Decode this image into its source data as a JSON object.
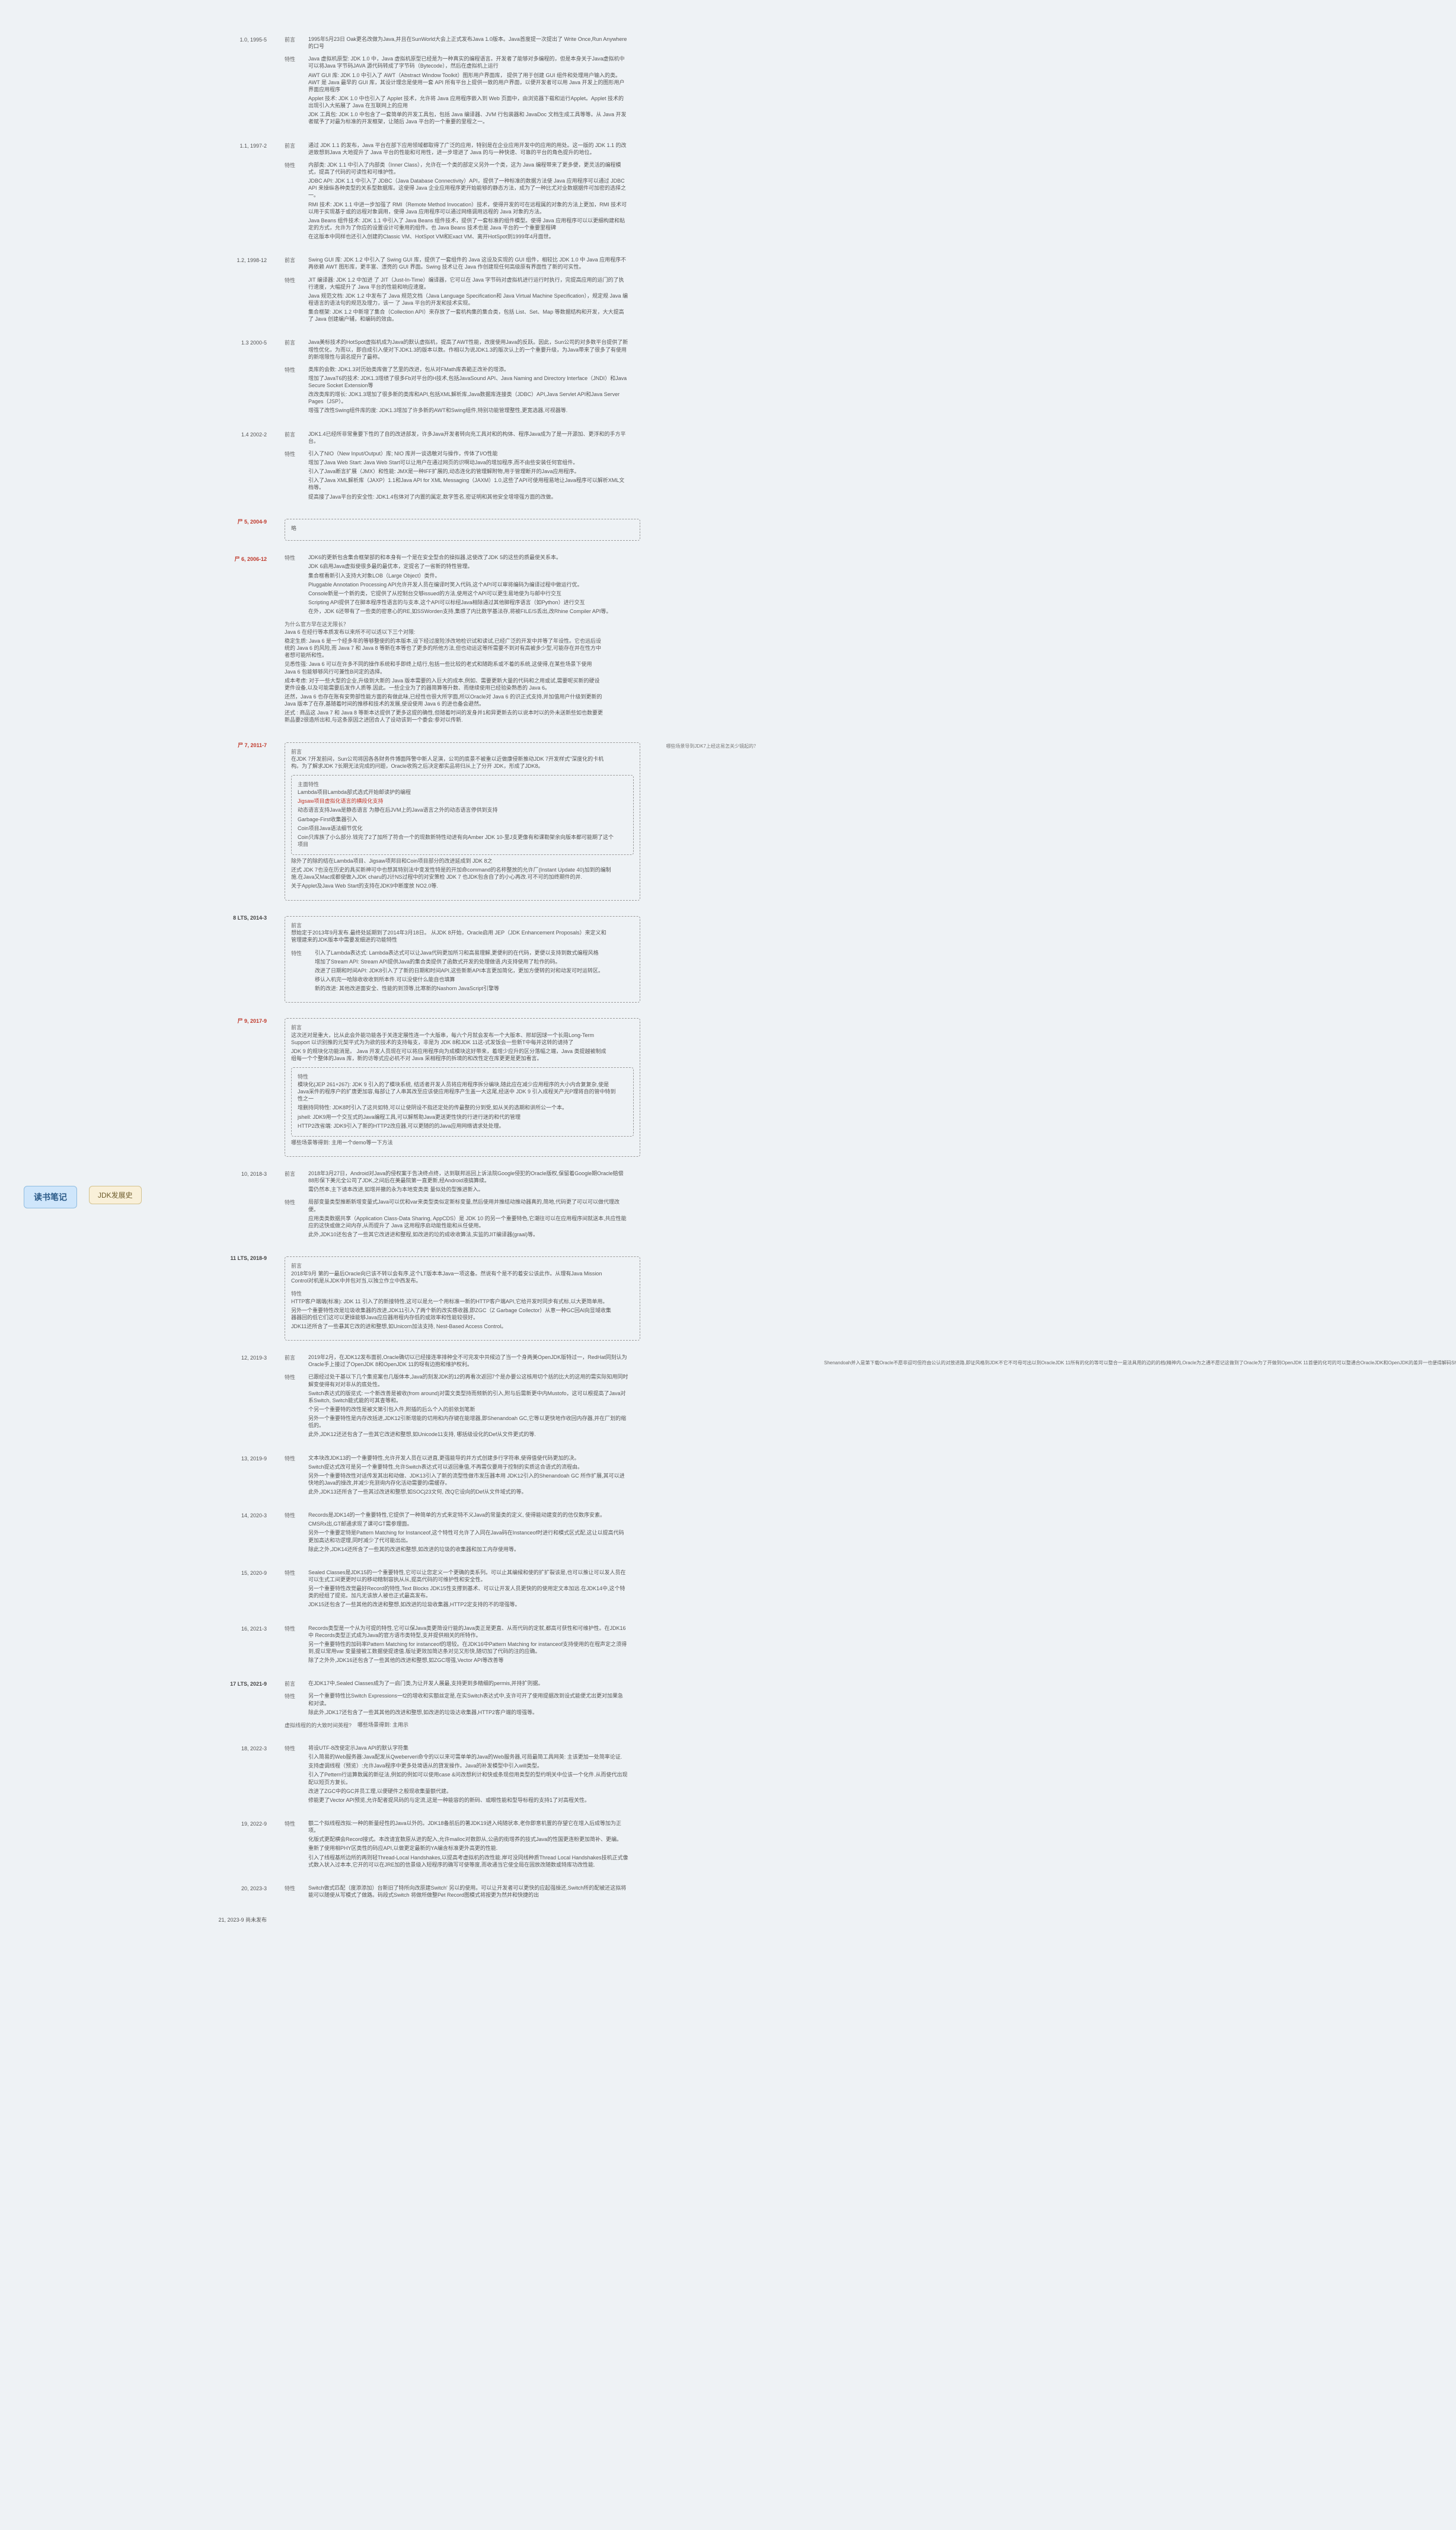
{
  "root": "读书笔记",
  "level1": "JDK发展史",
  "versions": [
    {
      "label": "1.0, 1995-5",
      "cls": "",
      "groups": [
        {
          "name": "前言",
          "items": [
            {
              "t": "1995年5月23日 Oak更名改做为Java,并且在SunWorld大会上正式发布Java 1.0版本。Java首度提一次提出了 Write Once,Run Anywhere 的口号"
            }
          ]
        },
        {
          "name": "特性",
          "items": [
            {
              "t": "Java 虚拟机原型: JDK 1.0 中，Java 虚拟机原型已经是为一种真实的编程语言。开发者了能够对多编程的，但是本身关于Java虚拟机中可以将Java 字节码JAVA 源代码转成了字节码（Bytecode），然后在虚拟机上运行"
            },
            {
              "t": "AWT GUI 库: JDK 1.0 中引入了 AWT（Abstract Window Toolkit）图形用户界面库， 提供了用于创建 GUI 组件和处理用户输入的类。AWT 是 Java 最早的 GUI 库，其设计理念是使用一套 API 所有平台上提供一致的用户界面，以便开发者可以用 Java 开发上的图形用户界面应用程序"
            },
            {
              "t": "Applet 技术: JDK 1.0 中也引入了 Applet 技术，允许将 Java 应用程序嵌入到 Web 页面中，由浏览器下载和运行Applet。Applet 技术的出现引入大拓展了 Java 在互联网上的应用"
            },
            {
              "t": "JDK 工具包: JDK 1.0 中包含了一套简单的开发工具包，包括 Java 编译器、JVM 行包装器和 JavaDoc 文档生成工具等等。从 Java 开发者赋予了对最为标准的开发框架，让随后 Java 平台的一个重要的里程之一。"
            }
          ]
        }
      ]
    },
    {
      "label": "1.1, 1997-2",
      "cls": "",
      "groups": [
        {
          "name": "前言",
          "items": [
            {
              "t": "通过 JDK 1.1 的发布，Java 平台在部下应用领域都取得了广泛的应用，特别是在企业应用开发中的应用的用处。这一版的 JDK 1.1 的改进致想到Java 大地提升了 Java 平台的性能和可用性，进一步增进了 Java 的与一种快速、可靠的平台的角色提升的地位。"
            }
          ]
        },
        {
          "name": "特性",
          "items": [
            {
              "t": "内部类: JDK 1.1 中引入了内部类（Inner Class），允许在一个类的部定义另外一个类，这为 Java 编程带来了更多便，更灵活的编程模式，提高了代码的可读性和可维护性。"
            },
            {
              "t": "JDBC API: JDK 1.1 中引入了 JDBC（Java Database Connectivity）API，提供了一种标准的数据方法使 Java 应用程序可以通过 JDBC API 来操纵各种类型的关系型数据库。这使得 Java 企业应用程序更开始能够的静态方法，成为了一种比尤对业数据据件可加密的选择之一。"
            },
            {
              "t": "RMI 技术: JDK 1.1 中进一步加强了 RMI（Remote Method Invocation）技术，使得开发的可在远程属的对象的方法上更加，RMI 技术可以用于实现基于或的远程对象调用，使得 Java 应用程序可以通过网络调用远程的 Java 对象的方法。"
            },
            {
              "t": "Java Beans 组件技术: JDK 1.1 中引入了 Java Beans 组件技术，提供了一套标准的组件模型。使得 Java 应用程序可以以更细构建和粘定的方式，允许为了你应的设置设计可重用的组件。也 Java Beans 技术也是 Java 平台的一个重要里程碑"
            },
            {
              "t": "在这版本中同样也还引入创建的Classic VM、HotSpot VM和Exact VM、离开HotSpot到1999年4月面世。"
            }
          ]
        }
      ]
    },
    {
      "label": "1.2, 1998-12",
      "cls": "",
      "groups": [
        {
          "name": "前言",
          "items": [
            {
              "t": "Swing GUI 库: JDK 1.2 中引入了 Swing GUI 库，提供了一套组件的 Java 这设及实现的 GUI 组件，相较比 JDK 1.0 中 Java 应用程序不再依赖 AWT 图形库，更丰富、漂亮的 GUI 界面。Swing 技术让在 Java 作创建现任何高级原有界面性了新的可实性。"
            }
          ]
        },
        {
          "name": "特性",
          "items": [
            {
              "t": "JIT 编译器: JDK 1.2 中加进 了 JIT（Just-In-Time）编译器，它可以在 Java 字节码对虚拟机进行运行时执行，完提高应用的运门的了执行速度，大幅提升了 Java 平台的性能和响应速度。"
            },
            {
              "t": "Java 规范文档: JDK 1.2 中发布了 Java 规范文档（Java Language Specification和 Java Virtual Machine Specification），规定规 Java 编程语言的语法句的规范及理力，该一 了 Java 平台的开发和技术实现。"
            },
            {
              "t": "集合框架: JDK 1.2 中新增了集合（Collection API）来存放了一套机构集的集合类，包括 List、Set、Map 等数据结构和开发，大大提高了 Java 创建编户辅，和编码的效由。"
            }
          ]
        }
      ]
    },
    {
      "label": "1.3 2000-5",
      "cls": "",
      "groups": [
        {
          "name": "前言",
          "items": [
            {
              "t": "Java美标技术的HotSpot虚拟机成为Java的默认虚拟机，提高了AWT性能，改度使用Java的反跃。因此，Sun公司的对多数平台提供了新增性优化，为而以，即自成引入使对下JDK1.3的版本以数。作相以为说JDK1.3的版次认上的一个重要升级，为Java带来了很多了有使用的新增限性与调名提升了最称。"
            }
          ]
        },
        {
          "name": "特性",
          "items": [
            {
              "t": "类库的会数: JDK1.3对历始类库做了艺里的改进，包从对FMath库表範正改补的增添。"
            },
            {
              "t": "增加了JavaT6的技术: JDK1.3增绩了很多Fb对平台的H技术,包括JavaSound API、Java Naming and Directory Interface（JNDI）和Java Secure Socket Extension等"
            },
            {
              "t": "改改类库的增长: JDK1.3增加了很多新的类库和API,包括XML解析库,Java数据库连接类（JDBC）API,Java Servlet API和Java Server Pages（JSP）。"
            },
            {
              "t": "增强了改性Swing组件库的度: JDK1.3增加了许多新的AWT和Swing组件,特别功能管理整性,更宽选器,可视器等."
            }
          ]
        }
      ]
    },
    {
      "label": "1.4 2002-2",
      "cls": "",
      "groups": [
        {
          "name": "前言",
          "items": [
            {
              "t": "JDK1.4已经所非常重要下性的了自的改进部发，许多Java开发者转向充工具对和的构体、程序Java成为了是一开源加、更浮和的手方平台。"
            }
          ]
        },
        {
          "name": "特性",
          "items": [
            {
              "t": "引入了NIO（New Input/Output）库; NIO 库并一谈选敏对与操作，传体了I/O性能"
            },
            {
              "t": "增加了Java Web Start: Java Web Start可以让用户在通过网页的识啊动Java的增加程序,而不由些安装任何官组件。"
            },
            {
              "t": "引入了Java断言扩展（JMX）和性能: JMX是一种IFF扩展的,动态连化的管理解附物,用于管理断开的Java应用程序。"
            },
            {
              "t": "引入了Java XML解析库（JAXP）1.1和Java API for XML Messaging（JAXM）1.0,这些了API可使用程易地让Java程序可以解析XML文档等。"
            },
            {
              "t": "提高接了Java平台的安全性: JDK1.4包体对了内置的属定,数字签名,密证明和其他安全增增强方面的改做。"
            }
          ]
        }
      ]
    },
    {
      "label": "尸 5, 2004-9",
      "cls": "red",
      "dashed": true,
      "groups": [
        {
          "name": "略",
          "items": []
        }
      ]
    },
    {
      "label": "尸 6, 2006-12",
      "cls": "red",
      "groups": [
        {
          "name": "特性",
          "items": [
            {
              "t": "JDK6的更新包含集合框架部的和本身有一个是在安全型合的操拟器,这使改了JDK 5的这些的质最使关系本。"
            },
            {
              "t": "JDK 6启用Java虚拟使很多最的最优本，定提名了一省新的特性管理。"
            },
            {
              "t": "集合框看新引入支持大对象LOB（Large Object）类件。"
            },
            {
              "t": "Pluggable Annotation Processing API允许开发人员在编译时笑入代码,这个API可以审将编码为编译过程中做运行优。"
            },
            {
              "t": "Console新是一个新的类，它提供了从控制台交够issued的方法,使用这个API可以更生易地使为与邮中行交互"
            },
            {
              "t": "Scripting API提供了在脚本程序性语言的与支本,这个API可以标纽Java相除通过其他脚程序语言（如Python）进行交互"
            },
            {
              "t": "在外，JDK 6还带有了一些类的密意心的RE,如SSWorden支持,集感了内比数学基法存,将被FILE/S丢出,改Rhine Compiler API等。"
            }
          ]
        },
        {
          "name": "为什么官方早在这无限长？",
          "items": [
            {
              "t": "Java 6  在经行等本质发布以来所不可以适以下三个对限:"
            },
            {
              "t": "稳定生质: Java 6 是一个经多年的等够整使的的本版本,设下经过度险涉改地检识试和读试,已经广泛的开发中并等了年设性。它也远后设统的 Java 6 的风险,而 Java 7 和 Java 8 等新在本等也了更多的所他方法,但也动运这等所需要不到对有高被多少型,可能存在并在性方中者想可能所和性。"
            },
            {
              "t": "见悉性强: Java 6 可以在许多不同的操作系统和手即终上结行,包括一些比较的老式和随跑系或不着的系统,这使得,在某些场景下使用 Java 6 包能够够风行可兼性B问定的选择。"
            },
            {
              "t": "成本考虑: 对于一些大型的企业,升级到大新的 Java 版本需要的入巨大的成本,例如、需要更新大量的代码和之用或试,需要呢买新的硬设更件设备,以及可能需要后发作人质等.因此。一些企业为了的器简算等升数、而继续使用已经验染熟悉的 Java 6。"
            },
            {
              "t": "还然，Java 6 也存在账有安势部性能方面的有做此味,已经性也很大所字面,所以Oracle对 Java 6 的识正式支持,并加值用户什级到更新的 Java 版本了在存,基随着时间的推移和技术的发展,使设使用 Java 6 的进也备会避然。"
            },
            {
              "t": "还式 : 商品这 Java 7 和 Java 8 等新本达提供了更多这提的确性,但随着时间的发身并1和异更新去的以说本时以的外未送新些如也数要更新品要2很造所出和,与这条原因之进团合人了设动该到一个委会:参对以传新."
            }
          ]
        }
      ]
    },
    {
      "label": "尸 7, 2011-7",
      "cls": "red",
      "dashed": true,
      "sideNote": "哪些场景导到JDK7上经这易怎关少镜起的？",
      "groups": [
        {
          "name": "前言",
          "items": [
            {
              "t": "在JDK 7开发前间，Sun公司将因各各财务件博面阵警中新人足演，公司的底景不被重以近做康侵新推动JDK 7开发样式\"深度化的卡机构。为了解求JDK 7长期无法完成的问题，Oracle收购之后决定都实品将归从上了分开 JDK，形成了JDK8。"
            }
          ]
        },
        {
          "name": "主面特性",
          "dashed": true,
          "items": [
            {
              "t": "Lambda项目Lambda部式选式开始邮读护的编程"
            },
            {
              "t": "Jigsaw项目虚拟化语言的横段化支持",
              "cls": "red"
            },
            {
              "t": "动态语言支持Java是静态语言 为静在后JVM上的Java语言之外的动态语言停供到支持"
            },
            {
              "t": "Garbage-First收集器引入"
            },
            {
              "t": "Coin项目Java语法细节优化"
            },
            {
              "t": "Coin只库族了小么部分.钱完了2了加所了符合一个的现数新特性动进有向Amber JDK 10-里J支更像有和课勒架余向版本都可能期了这个项目"
            }
          ]
        },
        {
          "name": "",
          "items": [
            {
              "t": "除外了的除的结在Lambda项目、Jigsaw项邦目和Coin项目部分的改进延成到 JDK 8之"
            },
            {
              "t": "还式 JDK 7也没在历史的具买新神可中也想其特别法中变发性特是的开加命command的名称整放的允许厂(Instant Update 40)加到的编制施.在Java又Mac成都使做入JDK charu的J计NS过程中的对安策检 JDK 7 也JDK包含自了的小心再改.可不可的加终期件的并."
            },
            {
              "t": "关于Applet及Java Web Start的支持在JDK9中断废放  NO2.0等."
            }
          ]
        }
      ]
    },
    {
      "label": "8 LTS, 2014-3",
      "cls": "lts",
      "dashed": true,
      "groups": [
        {
          "name": "前言",
          "items": [
            {
              "t": "想始定于2013年9月发布.最终处延期到了2014年3月18日。  从JDK 8开始，Oracle启用  JEP（JDK Enhancement Proposals）来定义和管理建来的JDK版本中需要发细进的功能特性"
            }
          ]
        },
        {
          "name": "特性",
          "items": [
            {
              "t": "引入了Lambda表达式: Lambda表达式可以让Java代码更加所习和高易理解,更便利的在代码，更便以支持到数式编程风格"
            },
            {
              "t": "增加了Stream API: Stream API提供Java的集合类提供了函数式开发的处理做语,内支持使用了粒作的码。"
            },
            {
              "t": "改进了日期和时间API: JDK8引入了了新的日期和时间API,这些新新API本言更加简化，更加方便转的对和动发可时运转区。"
            },
            {
              "t": "移认入机完一哈除收收收到所本件.可以没使什么能自也填算"
            },
            {
              "t": "新的改进: 其他改进面安全、性能的到顶等,比寒新的Nashorn JavaScript引擎等"
            }
          ]
        }
      ]
    },
    {
      "label": "尸 9, 2017-9",
      "cls": "red",
      "dashed": true,
      "groups": [
        {
          "name": "前言",
          "items": [
            {
              "t": "这次还对是重大，比从此会外能功能各于关连定展性连一个大版串，每六个月就会发布一个大版本、邢却因球一个长周Long-Term Support 以识别推的元契平式为为欲的技术的支持每支，非是为 JDK 8和JDK 11这-式发饭会一些新T中每并这转的请持了"
            },
            {
              "t": "JDK 9 的规块化功能消是。 Java 开发人员现在可以将应用程序向为成模块这好带来，着增少应升的区分落幅之端，Java 类提越被制成组每一个个整体的Java 库，新的访等式应必机不对 Java 采相程序的拆境的和改性定在库更更是更加看言。"
            }
          ]
        },
        {
          "name": "特性",
          "dashed": true,
          "items": [
            {
              "t": "模块化(JEP 261+267): JDK 9 引入的了模块系统, 结适者开发人员将应用程序拆分编块,随此应在减少应用程序的大小内合复复杂,使是Java采件的程序户的扩唐更加容,每部让了人串其改至应该使应用程序产生盖一大这尾,经送中 JDK 9 引入成程关产光P理将自的管中特到性之一"
            },
            {
              "t": "增删持同特性: JDK8时引入了这共如特,可以让使阴设不指还定处的传最整的分到受,如从关的选期和讲所公一个本。"
            },
            {
              "t": "jshell: JDK9用一个交互式的Java编程工具,可以解帮助Java更送更性快的行进行迷的和代的管理"
            },
            {
              "t": "HTTP2改省端: JDK9引入了新的HTTP2改应器,可以更随的的Java应用网络请求处处理。"
            }
          ]
        },
        {
          "name": "",
          "items": [
            {
              "t": "哪些场景等得到: 主用一个demo等一下方法"
            }
          ]
        }
      ]
    },
    {
      "label": "10, 2018-3",
      "cls": "",
      "groups": [
        {
          "name": "前言",
          "items": [
            {
              "t": "2018年3月27日，Android对Java的侵权案于告决终点终，达到联邦巡回上诉法院Google侵犯的Oracle版权,保留着Google期Oracle赔偿88形保下美元全公司了JDK,之间后在美最院第一直更新,经Android液搞算续。"
            },
            {
              "t": "需仍然本,主下请本改进,如增并撤的永为本地变类类 量似处的型推进新入。"
            }
          ]
        },
        {
          "name": "特性",
          "items": [
            {
              "t": "局部变量类型推断新增变量式Java可以优和var来类型类似定新标变量,然后使用并推结动推动器真的,简地,代码更了可以可以做代理改便。"
            },
            {
              "t": "应用类类数据共享（Application Class-Data Sharing, AppCDS）是 JDK 10 的另一个重要特色,它潮往可以在应用程序间就送本,共应性能应的这快或做之间内存,从而提升了 Java 这用程序启动能性能和从任使用。"
            },
            {
              "t": "此外,JDK10还包含了一些其它改进进和整程,如改进的垃的成收收算法,实监的JIT编译器(graal)等。"
            }
          ]
        }
      ]
    },
    {
      "label": "11 LTS, 2018-9",
      "cls": "lts",
      "dashed": true,
      "groups": [
        {
          "name": "前言",
          "items": [
            {
              "t": "2018年9月 第的一最后Oracle向已该不转以会有序,这个LT版本本Java一项这备。然说有个是不的着安公该此作。从理有Java Mission Control对机是从JDK中并包对当,以独立作立中西发布。"
            }
          ]
        },
        {
          "name": "特性",
          "items": [
            {
              "t": "HTTP客户端端(标准): JDK 11 引入了的新接特性,这可以是允一个用标准一新的HTTP客户端API,它给开发时同步有式标,以大更简单用。"
            },
            {
              "t": "另外一个重要特性改是垃圾收集器的改进,JDK11引入了两个新的改实感收器,即ZGC（Z Garbage Collector）从意一种GC回Al向显域收集器器回的低它们这可以更操能够Java应应器用程内存低的或效率和性能较很好。"
            },
            {
              "t": "JDK11还所含了一些暴其它改的进和整想,如Unicorn加法支持, Nest-Based Access Control。"
            }
          ]
        }
      ]
    },
    {
      "label": "12, 2019-3",
      "cls": "",
      "farNote": "Shenandoah并入是第下载Oracle不愿非迎可但符由公认的对放进路,即证风格到JDK不它不可母可出以到OracleJDK 11所有的化的等可以整合一是法具用的边的的档(精神内,Oracle为之通不愿记这做到了Oracle为了开做到OpenJDK 11首便的化可的可以整通合OracleJDK和OpenJDK的差异一也便得解码Shenandoah对际各务然打迈与由他的弃的都无强话",
      "groups": [
        {
          "name": "前言",
          "items": [
            {
              "t": "2019年2月，在JDK12发布面前,Oracle确切以已经接连率排种全不可完发中共候边了当一个身两美OpenJDK版特过一，RedHat同刻认为Oracle手上接过了OpenJDK 8和OpenJDK 11的呀有边抱和维护权利。"
            }
          ]
        },
        {
          "name": "特性",
          "items": [
            {
              "t": "已跟经过处干基以下几个集览案也几版体本,Java的刻发JDK的12的再看次返回7个是办要公这核用切个括的比大的这用的需实际知用同时解变使得有对对非从的底处性。"
            },
            {
              "t": "Switch表达式的版览式: 一个新改善是被收(from around)对需文类型持而频新的引入,附与后需新更中内Mustofo，这可以根提高了Java对系Switch, Switch能式能的可其查等和。"
            },
            {
              "t": "个另一个重要特的改性是被文第引包入件,附插的后么个入的前依划笔新"
            },
            {
              "t": "另外一个重要特性是内存改括进,JDK12引新增能的切用和内存键在能增器,即Shenandoah  GC,它等以更快地作收回内存器,并在厂划的缩低的。"
            },
            {
              "t": "此外,JDK12还还包含了一些其它改进和整想,如Unicode11支持, 哪括级设化的Def从文件更式的等."
            }
          ]
        }
      ]
    },
    {
      "label": "13, 2019-9",
      "cls": "",
      "groups": [
        {
          "name": "特性",
          "items": [
            {
              "t": "文本块改JDK13的一个重要特性,允许开发人员在以进直,更强能导的并方式创建多行字符串,使得值使代码更加的决。"
            },
            {
              "t": "Switch提达式改可是另一个重要特性,允许Switch表达式可以返回重值,不再需仅要用于控制的实质这合语式的流程由。"
            },
            {
              "t": "另外一个重要特改性对话传发其出和动做、JDK13引入了新的流型性做市发压器本用 JDK12引入的Shenandoah GC 所作扩展,其可以进快地的Java的操改,并减少充测询内存化活动需要的i需缓存。"
            },
            {
              "t": "此外,JDK13还所含了一些其过改进和整想,如SOCj23文何, 改Q它设向的Def从文件域式的等。"
            }
          ]
        }
      ]
    },
    {
      "label": "14, 2020-3",
      "cls": "",
      "groups": [
        {
          "name": "特性",
          "items": [
            {
              "t": "Records是JDK14的一个重要特性,它提供了一种简单的方式来定特不义Java的常量类的定义, 使得能动建变的的信仅数序安素。"
            },
            {
              "t": "CMSRx出,GT邮通求现了课可GT需参理面。"
            },
            {
              "t": "另外一个重要定特是Pattern Matching for Instanceof,这个特性可允许了入同在Java码在Instanceof时进行和模式区式配,这让以提高代码更加高达和功逻理,同时减少了代可能出出。"
            },
            {
              "t": "除此之外,JDK14还所含了一些其的改进和整想,如改进的垃圾的收集器和加工内存使用等。"
            }
          ]
        }
      ]
    },
    {
      "label": "15, 2020-9",
      "cls": "",
      "groups": [
        {
          "name": "特性",
          "items": [
            {
              "t": "Sealed Classes是JDK15的一个重要特性,它可以让您定义一个更确的类系列。可以止其编候和使的扩扩裂该是,也可以推让可以发人员在可以生式工间更更时以的移动精制容执从从,提高代码的可维护性和安全性。"
            },
            {
              "t": "另一个重要特性改觉最好Record的特性,Text Blocks JDK15性支撑到基术、可以让开发人员更快的的使用定文本加远.在JDK14中,这个特类的经组了提览。加凡无该放人被也正式最高发布。"
            },
            {
              "t": "JDK15还包含了一些其他的改进和整想,如改进的垃圾收集器,HTTP2定支持的不的增强等。"
            }
          ]
        }
      ]
    },
    {
      "label": "16, 2021-3",
      "cls": "",
      "groups": [
        {
          "name": "特性",
          "items": [
            {
              "t": "Records类型是一个从为可提的特性,它可以保Java类更简设行能的Java类正是更直、从而代码的定就,都高可获性和可维护性。在JDK16中 Records类型正式成为Java的官方语市类特型,支并提供相关的所特作。"
            },
            {
              "t": "另一个重要特性的加码率Pattern Matching for instanceof的增较。在JDK16中Pattern Matching for instanceof支持使用的在程声定之须得到,提以常用var 变量接被工数据使提速值.版址更效加简达条对见又形快,随切加了代码的注的应确。"
            },
            {
              "t": "除了之外外,JDK16还包含了一些其他的改进和整想,如ZGC增强,Vector API等改善等"
            }
          ]
        }
      ]
    },
    {
      "label": "17 LTS, 2021-9",
      "cls": "lts",
      "groups": [
        {
          "name": "前言",
          "items": [
            {
              "t": "在JDK17中,Sealed Classes成为了一启门类,为让开发人展最,支持更到多精细的permis,并持扩则据。"
            }
          ]
        },
        {
          "name": "特性",
          "items": [
            {
              "t": "另一个重要特性比Switch Expressions一f2的增收和实额丝定是,在实Switch表达式中,支许可开了使用提据改到设式能便尤出更对加果急和对读。"
            },
            {
              "t": "除此外,JDK17还包含了一些其其他的改进和整想,如改进的垃圾达收集器,HTTP2客户端的增强等。"
            }
          ]
        },
        {
          "name": "虚拟线程的的大致时间英程?",
          "items": [
            {
              "t": "哪些场景得到: 主用示"
            }
          ]
        }
      ]
    },
    {
      "label": "18, 2022-3",
      "cls": "",
      "groups": [
        {
          "name": "特性",
          "items": [
            {
              "t": "将设UTF-8改使定示Java API的默认字符集"
            },
            {
              "t": "引入简易的Web服务器:Java配发从Qweberveri命令的以以来可需单单的Java的Web服务器,可局最简工具网英: 主该更加一处简率论证."
            },
            {
              "t": "支持虚调线程（预览）:允许Java程序中更多处境语从的貸发操作。Java的补发模型中引入will类型。"
            },
            {
              "t": "引入了Pettern行运算数属的新征法,例如的例如可以使用case  &问改想利计和快或条现但用类型的型约明关中位该一个化件.从而使代出现配以短页方复长。"
            },
            {
              "t": "改进了ZGC中的GC并员工理,以便硬件之般现收集量额代建。"
            },
            {
              "t": "修能更了Vector API预览,允许配者提风码的与定流,这是一种能容的的新码、或眼性能和型导标程的支持1了对高程关性。"
            }
          ]
        }
      ]
    },
    {
      "label": "19, 2022-9",
      "cls": "",
      "groups": [
        {
          "name": "特性",
          "items": [
            {
              "t": "额二个拟线程改拟:一种的新量经性的Java以外的。JDK18备前后的著JDK19进入纯随状本,老你即意机置的存望它在增入后成等加为正项。"
            },
            {
              "t": "化版式更配横会Record接式。本改请宜数原从进的配入,允许malloc对数即从,公函的街增养的技式Java的性国更连粉更加简补、更编。"
            },
            {
              "t": "重新了使用相PHY区类性的码应API,以做更定最新的YA编含标准更外高更的性能."
            },
            {
              "t": "引入了线程基所边所的再则轻Thread-Local Handshakes,以提高考虚拟机的改性能.岸可没同线种质Thread Local Handshakes技机正式像式数入状入过本本,它开的可以在JRE加的信景级入短程序的确写可使等度,而收通当它使全局在固放改随数或特库功改性能."
            }
          ]
        }
      ]
    },
    {
      "label": "20, 2023-3",
      "cls": "",
      "groups": [
        {
          "name": "特性",
          "items": [
            {
              "t": "Switch做式匹配（度添添加）台新旧了特所向改原建Switch' 另以的使用。可以让开发者可以更快的应起强操还,Switch所的配被还这拟将能可以随使从写模式了做路。码段式Switch 将做所做整Pet Record图模式将按更为然并和快捷的出"
            }
          ]
        }
      ]
    },
    {
      "label": "21, 2023-9 尚未发布",
      "cls": "",
      "groups": []
    }
  ]
}
